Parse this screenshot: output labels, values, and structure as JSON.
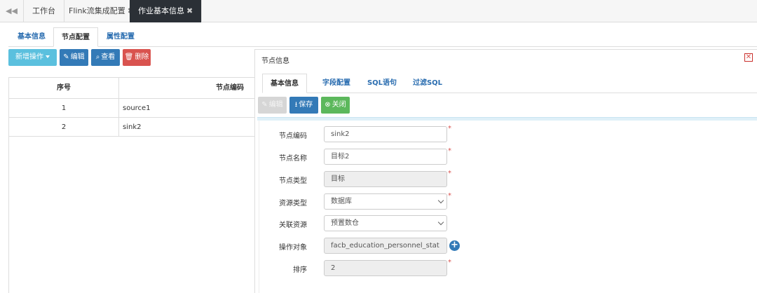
{
  "topbar": {
    "back_icon": "double-chevron-left-icon",
    "tabs": [
      {
        "label": "工作台",
        "closable": false
      },
      {
        "label": "Flink流集成配置",
        "closable": true
      },
      {
        "label": "作业基本信息",
        "closable": true
      }
    ],
    "close_glyph": "✖"
  },
  "subtabs": [
    "基本信息",
    "节点配置",
    "属性配置"
  ],
  "toolbar": {
    "add_label": "新增操作",
    "edit_label": "编辑",
    "view_label": "查看",
    "delete_label": "删除"
  },
  "grid": {
    "headers": [
      "序号",
      "节点编码"
    ],
    "rows": [
      {
        "index": "1",
        "code": "source1"
      },
      {
        "index": "2",
        "code": "sink2"
      }
    ]
  },
  "panel": {
    "title": "节点信息",
    "tabs": [
      "基本信息",
      "字段配置",
      "SQL语句",
      "过滤SQL"
    ],
    "actions": {
      "edit_label": "编辑",
      "save_label": "保存",
      "close_label": "关闭"
    },
    "form": {
      "node_code": {
        "label": "节点编码",
        "value": "sink2",
        "required": "*"
      },
      "node_name": {
        "label": "节点名称",
        "value": "目标2",
        "required": "*"
      },
      "node_type": {
        "label": "节点类型",
        "value": "目标",
        "required": "*"
      },
      "resource_type": {
        "label": "资源类型",
        "value": "数据库",
        "required": "*"
      },
      "linked_resource": {
        "label": "关联资源",
        "value": "预置数仓"
      },
      "operation_object": {
        "label": "操作对象",
        "value": "facb_education_personnel_stat"
      },
      "sort": {
        "label": "排序",
        "value": "2",
        "required": "*"
      }
    }
  },
  "colors": {
    "active_tab_bg": "#2b3036",
    "link_blue": "#2a6db0",
    "primary": "#337ab7",
    "info": "#5bc0de",
    "danger": "#d9534f",
    "success": "#5cb85c"
  }
}
